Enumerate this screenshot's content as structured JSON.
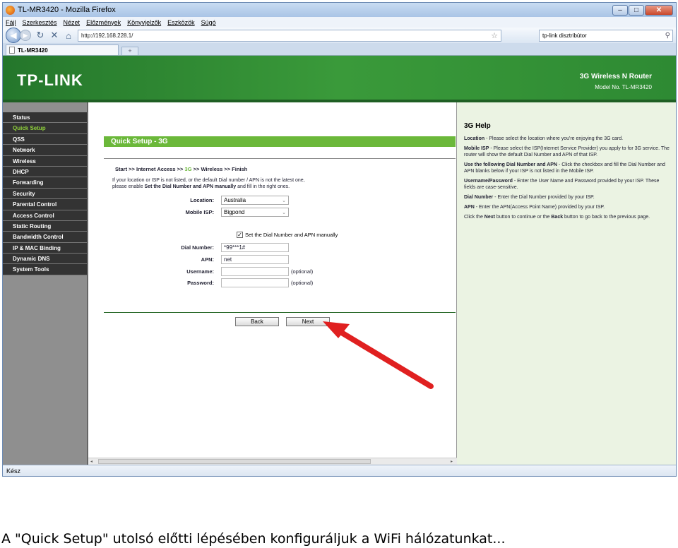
{
  "browser": {
    "window_title": "TL-MR3420 - Mozilla Firefox",
    "menu": [
      "Fájl",
      "Szerkesztés",
      "Nézet",
      "Előzmények",
      "Könyvjelzők",
      "Eszközök",
      "Súgó"
    ],
    "url": "http://192.168.228.1/",
    "search_text": "tp-link disztribútor",
    "tab_title": "TL-MR3420",
    "new_tab": "+",
    "status": "Kész"
  },
  "banner": {
    "logo": "TP-LINK",
    "router_name": "3G Wireless N Router",
    "router_model": "Model No. TL-MR3420"
  },
  "sidebar": {
    "items": [
      "Status",
      "Quick Setup",
      "QSS",
      "Network",
      "Wireless",
      "DHCP",
      "Forwarding",
      "Security",
      "Parental Control",
      "Access Control",
      "Static Routing",
      "Bandwidth Control",
      "IP & MAC Binding",
      "Dynamic DNS",
      "System Tools"
    ],
    "active": "Quick Setup"
  },
  "form": {
    "header": "Quick Setup - 3G",
    "steps_a": "Start >> Internet Access >> ",
    "steps_cur": "3G",
    "steps_b": " >> Wireless >> Finish",
    "intro_1": "If your location or ISP is not listed, or the default Dial number / APN is not the latest one,",
    "intro_2a": "please enable ",
    "intro_2b": "Set the Dial Number and APN manually",
    "intro_2c": " and fill in the right ones.",
    "location_label": "Location:",
    "location_value": "Australia",
    "isp_label": "Mobile ISP:",
    "isp_value": "Bigpond",
    "manual_label": "Set the Dial Number and APN manually",
    "dial_label": "Dial Number:",
    "dial_value": "*99***1#",
    "apn_label": "APN:",
    "apn_value": "net",
    "username_label": "Username:",
    "password_label": "Password:",
    "optional": "(optional)",
    "back": "Back",
    "next": "Next"
  },
  "help": {
    "title": "3G Help",
    "p1b": "Location",
    "p1": " - Please select the location where you're enjoying the 3G card.",
    "p2b": "Mobile ISP",
    "p2": " - Please select the ISP(Internet Service Provider) you apply to for 3G service. The router will show the default Dial Number and APN of that ISP.",
    "p3b": "Use the following Dial Number and APN",
    "p3": " - Click the checkbox and fill the Dial Number and APN blanks below if your ISP is not listed in the Mobile ISP.",
    "p4b": "Username/Password",
    "p4": " - Enter the User Name and Password provided by your ISP. These fields are case-sensitive.",
    "p5b": "Dial Number",
    "p5": " - Enter the Dial Number provided by your ISP.",
    "p6b": "APN",
    "p6": " - Enter the APN(Access Point Name) provided by your ISP.",
    "p7a": "Click the ",
    "p7b": "Next",
    "p7c": " button to continue or the ",
    "p7d": "Back",
    "p7e": " button to go back to the previous page."
  },
  "caption": "A \"Quick Setup\" utolsó előtti lépésében konfiguráljuk a WiFi hálózatunkat...",
  "colors": {
    "accent_green": "#6bb83a",
    "banner_green": "#2e8a33",
    "arrow_red": "#e02020"
  }
}
